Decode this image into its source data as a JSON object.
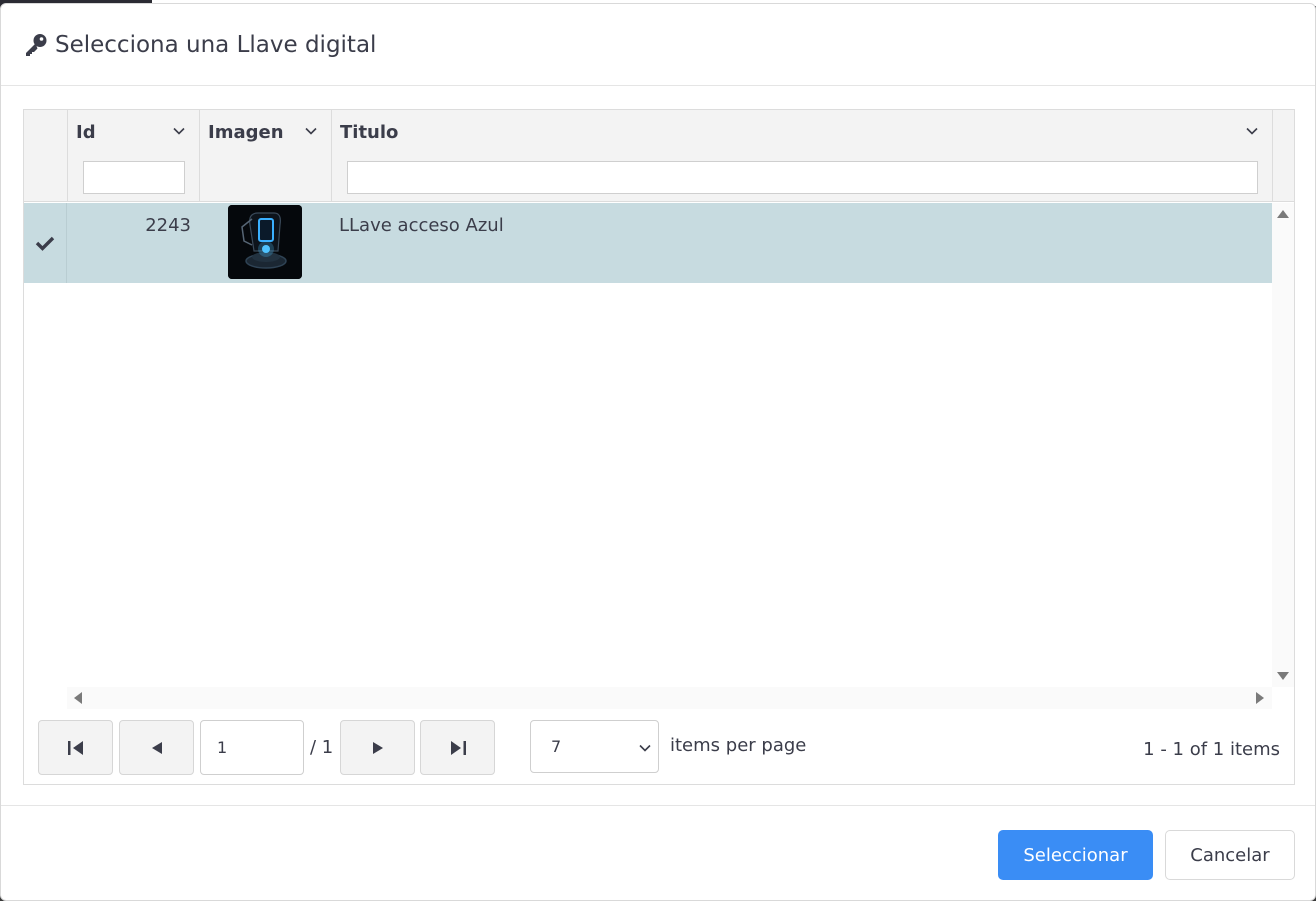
{
  "dialog": {
    "title": "Selecciona una Llave digital",
    "title_icon": "key-icon"
  },
  "grid": {
    "columns": [
      {
        "key": "select",
        "label": ""
      },
      {
        "key": "id",
        "label": "Id"
      },
      {
        "key": "imagen",
        "label": "Imagen"
      },
      {
        "key": "titulo",
        "label": "Titulo"
      }
    ],
    "filters": {
      "id": "",
      "titulo": ""
    },
    "rows": [
      {
        "selected": true,
        "id": "2243",
        "image_icon": "key-device-thumbnail",
        "titulo": "LLave acceso Azul"
      }
    ]
  },
  "pager": {
    "current_page": "1",
    "total_pages_label": "/ 1",
    "page_size": "7",
    "page_size_label": "items per page",
    "info": "1 - 1 of 1 items"
  },
  "footer": {
    "select_label": "Seleccionar",
    "cancel_label": "Cancelar"
  },
  "colors": {
    "primary": "#3a8df5",
    "selected_row": "#c7dbe0",
    "header_bg": "#f3f3f3"
  }
}
